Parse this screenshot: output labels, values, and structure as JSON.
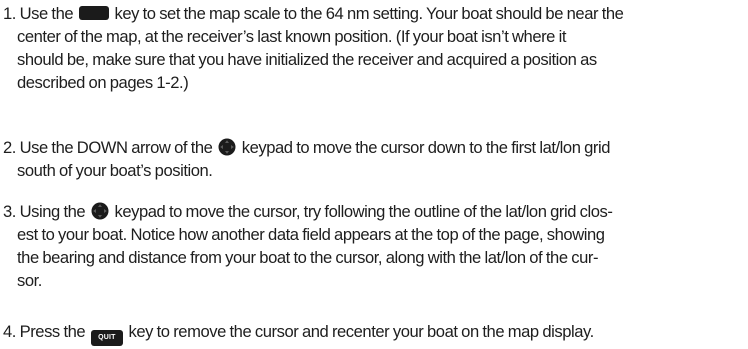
{
  "steps": [
    {
      "number": "1.",
      "before": " Use the ",
      "icon": "map-scale-key-icon",
      "lines": [
        " key to set the map scale to the 64 nm setting. Your boat should be near the",
        "center of the map, at the receiver’s last known position. (If your boat isn’t where it",
        "should be, make sure that you have initialized the receiver and acquired a position as",
        "described on pages 1-2.)"
      ]
    },
    {
      "number": "2.",
      "before": " Use the DOWN arrow of the ",
      "icon": "keypad-icon",
      "lines": [
        " keypad to move the cursor down to the first lat/lon grid",
        "south of your boat’s position."
      ]
    },
    {
      "number": "3.",
      "before": " Using the ",
      "icon": "keypad-icon",
      "lines": [
        " keypad to move the cursor, try following the outline of the lat/lon grid clos-",
        "est to your boat. Notice how another data field appears at the top of the page, showing",
        "the bearing and distance from your boat to the cursor, along with the lat/lon of the cur-",
        "sor."
      ]
    },
    {
      "number": "4.",
      "before": " Press the ",
      "icon": "quit-key-icon",
      "key_label": "QUIT",
      "lines": [
        " key to remove the cursor and recenter your boat on the map display."
      ]
    }
  ]
}
